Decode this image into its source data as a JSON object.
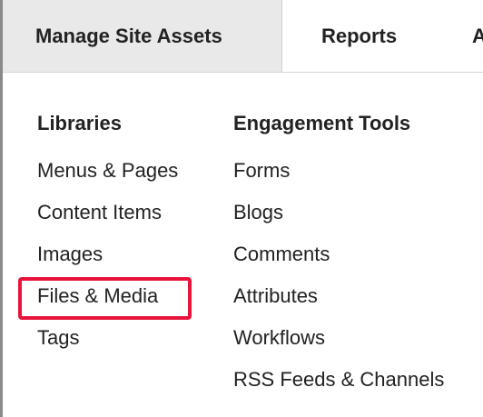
{
  "tabs": {
    "manage_site_assets": "Manage Site Assets",
    "reports": "Reports",
    "partial_next": "A"
  },
  "libraries": {
    "heading": "Libraries",
    "items": [
      "Menus & Pages",
      "Content Items",
      "Images",
      "Files & Media",
      "Tags"
    ]
  },
  "engagement": {
    "heading": "Engagement Tools",
    "items": [
      "Forms",
      "Blogs",
      "Comments",
      "Attributes",
      "Workflows",
      "RSS Feeds & Channels"
    ]
  },
  "colors": {
    "active_tab_bg": "#e9e9e9",
    "highlight_border": "#e8143c"
  }
}
